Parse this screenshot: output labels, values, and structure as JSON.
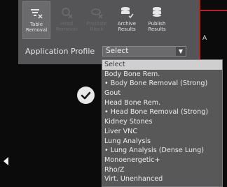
{
  "toolbar": {
    "tools": [
      {
        "label": "Table\nRemoval",
        "icon": "table-removal-icon",
        "state": "active"
      },
      {
        "label": "Head\nRemoval",
        "icon": "head-removal-icon",
        "state": "disabled"
      },
      {
        "label": "Prostate\nBlock",
        "icon": "prostate-icon",
        "state": "disabled"
      },
      {
        "label": "Archive\nResults",
        "icon": "archive-icon",
        "state": "enabled"
      },
      {
        "label": "Publish\nResults",
        "icon": "publish-icon",
        "state": "enabled"
      }
    ]
  },
  "profile": {
    "label": "Application Profile",
    "selected": "Select"
  },
  "dropdown": {
    "options": [
      "Select",
      "Body Bone Rem.",
      "• Body Bone Removal (Strong)",
      "Gout",
      "Head Bone Rem.",
      "• Head Bone Removal (Strong)",
      "Kidney Stones",
      "Liver VNC",
      "Lung Analysis",
      "• Lung Analysis (Dense Lung)",
      "Monoenergetic+",
      "Rho/Z",
      "Virt. Unenhanced"
    ],
    "selected_index": 0
  },
  "viewport": {
    "marker": "A"
  },
  "colors": {
    "panel": "#555557",
    "dropdown_bg": "#585859",
    "selected_bg": "#cfcfcf",
    "border_red": "#b3261e"
  }
}
